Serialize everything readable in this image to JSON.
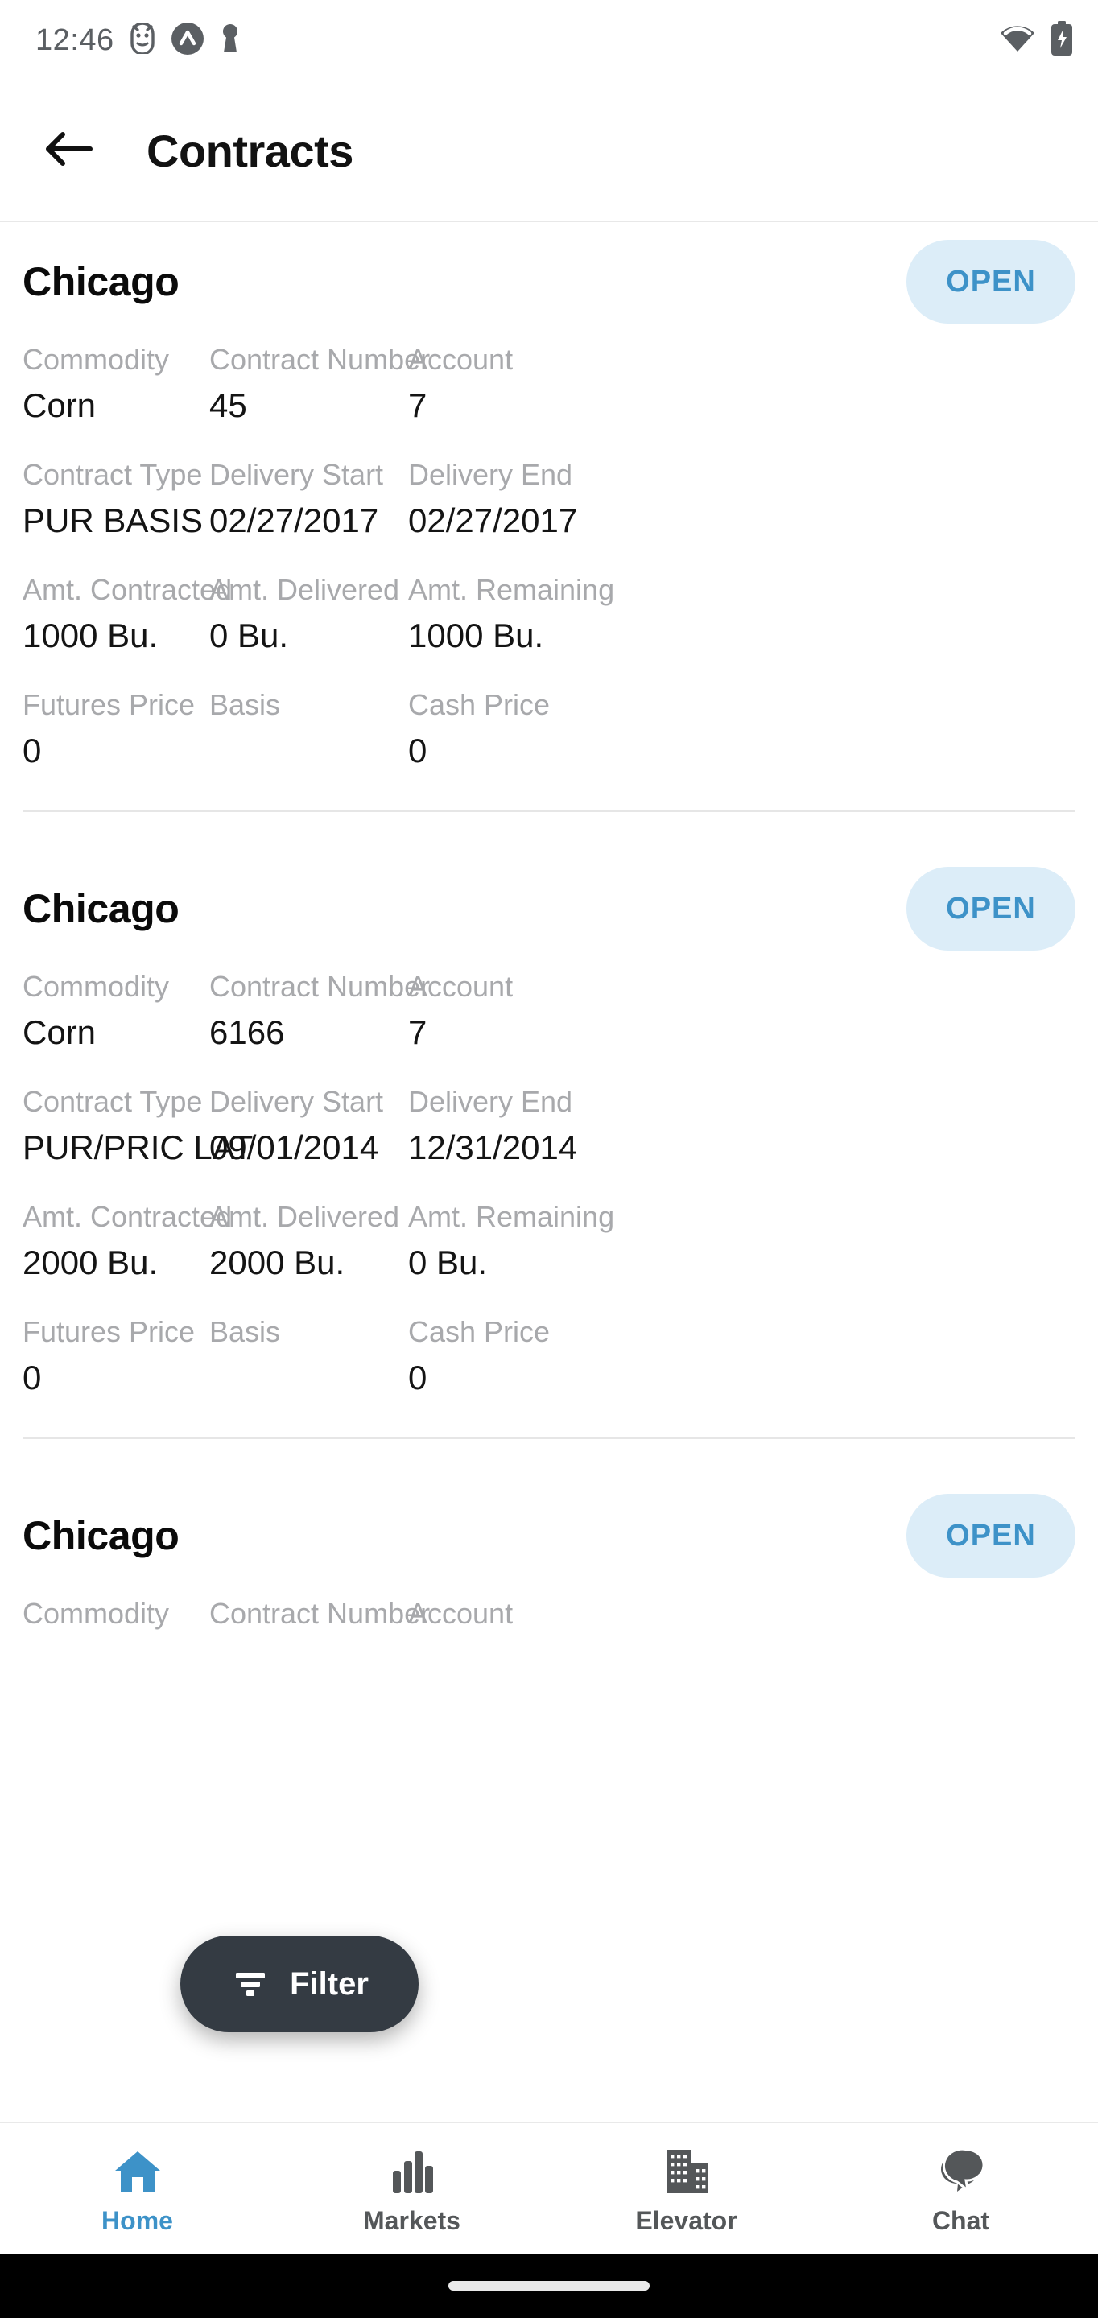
{
  "statusbar": {
    "time": "12:46",
    "icons": [
      "android-debug-icon",
      "vpn-key-circle-icon",
      "keyhole-icon"
    ],
    "right_icons": [
      "wifi-icon",
      "battery-charging-icon"
    ]
  },
  "appbar": {
    "back_icon": "arrow-left-icon",
    "title": "Contracts"
  },
  "fields": {
    "commodity": "Commodity",
    "contract_number": "Contract Number",
    "account": "Account",
    "contract_type": "Contract Type",
    "delivery_start": "Delivery Start",
    "delivery_end": "Delivery End",
    "amt_contracted": "Amt. Contracted",
    "amt_delivered": "Amt. Delivered",
    "amt_remaining": "Amt. Remaining",
    "futures_price": "Futures Price",
    "basis": "Basis",
    "cash_price": "Cash Price"
  },
  "colors": {
    "accent": "#3d92c8",
    "badge_bg": "#dcedf8",
    "fab_bg": "#343b43",
    "label_gray": "#a8a9ac",
    "value_black": "#141414"
  },
  "contracts": [
    {
      "location": "Chicago",
      "status": "OPEN",
      "commodity": "Corn",
      "contract_number": "45",
      "account": "7",
      "contract_type": "PUR BASIS",
      "delivery_start": "02/27/2017",
      "delivery_end": "02/27/2017",
      "amt_contracted": "1000 Bu.",
      "amt_delivered": "0 Bu.",
      "amt_remaining": "1000 Bu.",
      "futures_price": "0",
      "basis": "",
      "cash_price": "0"
    },
    {
      "location": "Chicago",
      "status": "OPEN",
      "commodity": "Corn",
      "contract_number": "6166",
      "account": "7",
      "contract_type": "PUR/PRIC LAT",
      "delivery_start": "09/01/2014",
      "delivery_end": "12/31/2014",
      "amt_contracted": "2000 Bu.",
      "amt_delivered": "2000 Bu.",
      "amt_remaining": "0 Bu.",
      "futures_price": "0",
      "basis": "",
      "cash_price": "0"
    },
    {
      "location": "Chicago",
      "status": "OPEN",
      "commodity": "Commodity",
      "contract_number": "Contract Number",
      "account": "Account"
    }
  ],
  "fab": {
    "label": "Filter",
    "icon": "filter-icon"
  },
  "bottomnav": {
    "items": [
      {
        "label": "Home",
        "icon": "home-icon",
        "active": true
      },
      {
        "label": "Markets",
        "icon": "bar-chart-icon",
        "active": false
      },
      {
        "label": "Elevator",
        "icon": "building-icon",
        "active": false
      },
      {
        "label": "Chat",
        "icon": "chat-icon",
        "active": false
      }
    ]
  }
}
